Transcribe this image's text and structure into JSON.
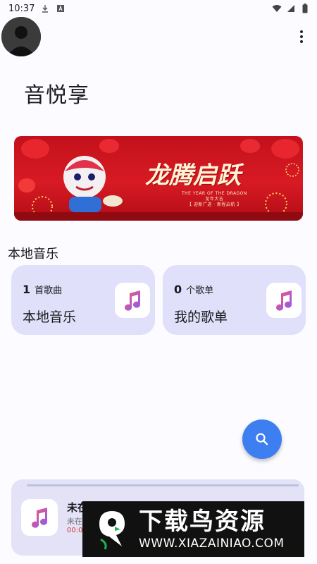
{
  "status_bar": {
    "time": "10:37",
    "icons": [
      "download-icon",
      "a-badge-icon",
      "wifi-icon",
      "cellular-icon",
      "battery-icon"
    ]
  },
  "header": {
    "avatar_icon": "user-avatar-icon",
    "more_icon": "more-vert-icon"
  },
  "app": {
    "title": "音悦享"
  },
  "banner": {
    "headline": "龙腾启跃",
    "subtitle_line1": "THE YEAR OF THE DRAGON",
    "subtitle_line2": "龙年大吉",
    "subtitle_line3": "【 迎新广进 · 新程启航 】"
  },
  "local_music": {
    "section_title": "本地音乐",
    "cards": [
      {
        "count": "1",
        "unit": "首歌曲",
        "label": "本地音乐",
        "icon": "music-note-icon"
      },
      {
        "count": "0",
        "unit": "个歌单",
        "label": "我的歌单",
        "icon": "music-note-icon"
      }
    ]
  },
  "fab": {
    "icon": "search-icon"
  },
  "mini_player": {
    "title": "未在播放",
    "artist": "未在",
    "time": "00:00",
    "progress": 0,
    "icon": "music-note-icon"
  },
  "watermark": {
    "name": "下载鸟资源",
    "url": "WWW.XIAZAINIAO.COM"
  },
  "colors": {
    "background": "#fcfbff",
    "card": "#e1e0fa",
    "fab": "#3d7ff0",
    "banner": "#c3111b"
  }
}
